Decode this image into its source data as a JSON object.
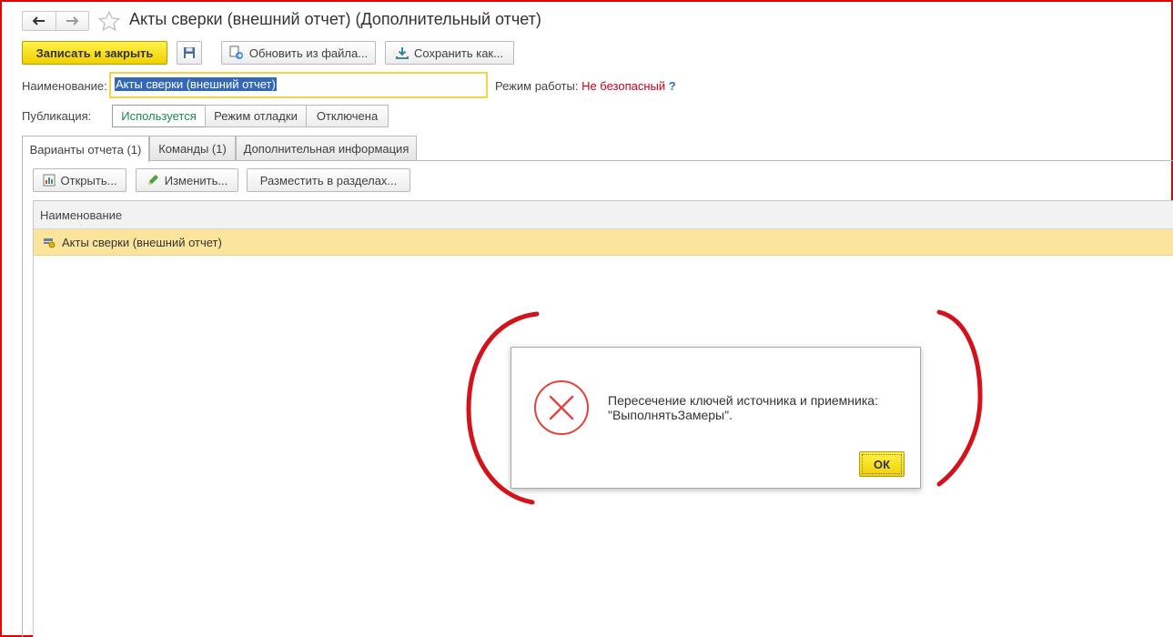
{
  "window": {
    "title": "Акты сверки (внешний отчет) (Дополнительный отчет)"
  },
  "toolbar": {
    "save_close_label": "Записать и закрыть",
    "update_from_file_label": "Обновить из файла...",
    "save_as_label": "Сохранить как..."
  },
  "form": {
    "name_label": "Наименование:",
    "name_value": "Акты сверки (внешний отчет)",
    "mode_label": "Режим работы:",
    "mode_value": "Не безопасный",
    "mode_help": "?",
    "publication_label": "Публикация:",
    "publication_options": [
      "Используется",
      "Режим отладки",
      "Отключена"
    ],
    "publication_selected": "Используется"
  },
  "tabs": [
    {
      "label": "Варианты отчета (1)",
      "active": true
    },
    {
      "label": "Команды (1)",
      "active": false
    },
    {
      "label": "Дополнительная информация",
      "active": false
    }
  ],
  "variants_toolbar": {
    "open_label": "Открыть...",
    "edit_label": "Изменить...",
    "place_label": "Разместить в разделах..."
  },
  "table": {
    "column_header": "Наименование",
    "rows": [
      "Акты сверки (внешний отчет)"
    ]
  },
  "dialog": {
    "message_line1": "Пересечение ключей источника и приемника:",
    "message_line2": "\"ВыполнятьЗамеры\".",
    "ok_label": "ОК"
  },
  "colors": {
    "frame_border": "#e60000",
    "primary_button": "#f1d000",
    "selected_row": "#fbe59c",
    "error_icon": "#e0443c",
    "annotation": "#d4121b",
    "danger_text": "#c8001e",
    "help_link": "#2f6fc0"
  }
}
